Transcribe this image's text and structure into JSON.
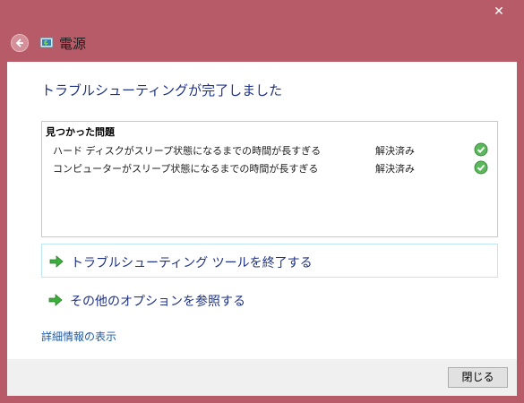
{
  "window": {
    "close_glyph": "✕",
    "title": "電源"
  },
  "main": {
    "heading": "トラブルシューティングが完了しました",
    "problems_header": "見つかった問題",
    "problems": [
      {
        "name": "ハード ディスクがスリープ状態になるまでの時間が長すぎる",
        "status": "解決済み",
        "icon": "check-icon"
      },
      {
        "name": "コンピューターがスリープ状態になるまでの時間が長すぎる",
        "status": "解決済み",
        "icon": "check-icon"
      }
    ],
    "actions": [
      {
        "label": "トラブルシューティング ツールを終了する",
        "icon": "green-arrow-icon"
      },
      {
        "label": "その他のオプションを参照する",
        "icon": "green-arrow-icon"
      }
    ],
    "details_link": "詳細情報の表示"
  },
  "footer": {
    "close_button": "閉じる"
  },
  "colors": {
    "frame": "#b85b68",
    "heading": "#1e3287",
    "link": "#1e5aa6",
    "check": "#4caf50"
  }
}
